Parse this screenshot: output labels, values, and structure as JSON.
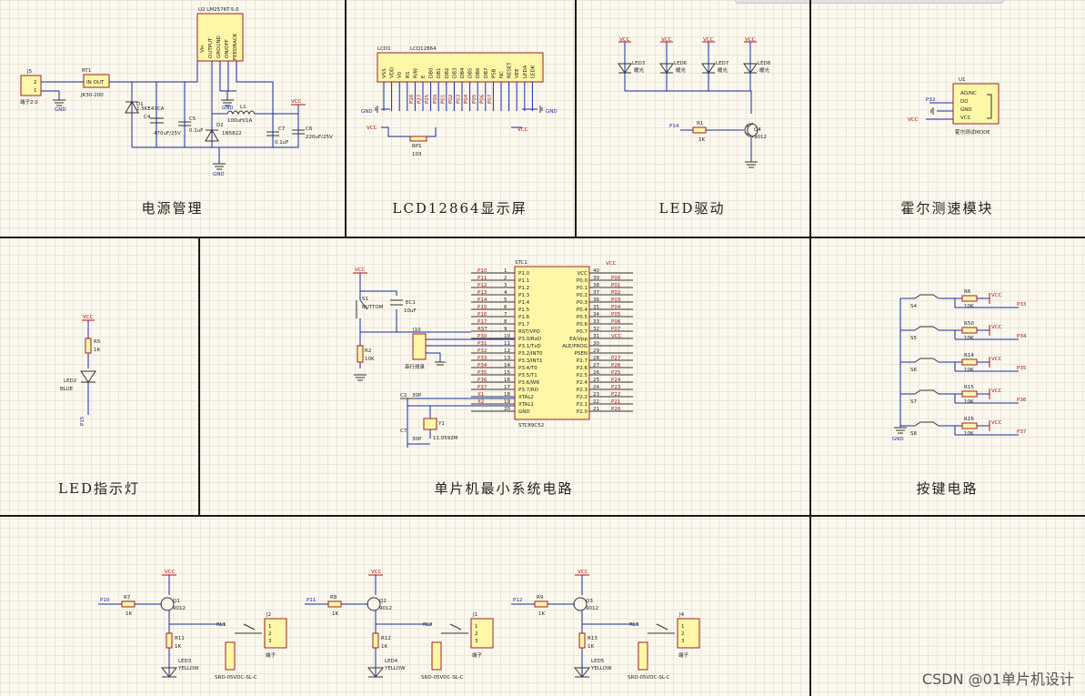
{
  "panels": {
    "power": {
      "title": "电源管理"
    },
    "lcd": {
      "title": "LCD12864显示屏"
    },
    "led_drive": {
      "title": "LED驱动"
    },
    "hall": {
      "title": "霍尔测速模块"
    },
    "led_indicator": {
      "title": "LED指示灯"
    },
    "mcu": {
      "title": "单片机最小系统电路"
    },
    "keys": {
      "title": "按键电路"
    }
  },
  "power_labels": {
    "u2": "U2  LM2576T-5.0",
    "u2_pins": [
      "Vin",
      "OUTPUT",
      "GROUND",
      "ON/OFF",
      "FEEDBACK"
    ],
    "j5": "J5",
    "j5_name": "端子2.0",
    "j5_pins": [
      "2",
      "1"
    ],
    "rt1": "RT1",
    "rt1_name": "IN OUT",
    "rt1_val": "JK30-200",
    "d1": "D1",
    "d1_val": "1.5KE47CA",
    "c4": "C4",
    "c4_val": "470uF/25V",
    "c5": "C5",
    "c5_val": "0.1uF",
    "d2": "D2",
    "d2_val": "1N5822",
    "l1": "L1",
    "l1_val": "100uH/1A",
    "c7": "C7",
    "c7_val": "0.1uF",
    "c6": "C6",
    "c6_val": "220uF/25V",
    "gnd": "GND",
    "vcc": "VCC"
  },
  "lcd_labels": {
    "ref": "LCD1",
    "name": "LCD12864",
    "pins": [
      "VSS",
      "VDD",
      "V0",
      "RS",
      "R/W",
      "E",
      "DB0",
      "DB1",
      "DB2",
      "DB3",
      "DB4",
      "DB5",
      "DB6",
      "DB7",
      "PSB",
      "NC",
      "RESET",
      "VEE",
      "LEDA",
      "LEDK"
    ],
    "nets": [
      "P26",
      "P27",
      "P25",
      "P00",
      "P01",
      "P02",
      "P03",
      "P04",
      "P05",
      "P06",
      "P07"
    ],
    "rp": "RP1",
    "rp_val": "103",
    "gnd": "GND",
    "vcc": "VCC"
  },
  "led_drive_labels": {
    "vcc": "VCC",
    "leds": [
      "LED3",
      "LED6",
      "LED7",
      "LED8"
    ],
    "led_val": "暖光",
    "r": "R1",
    "r_val": "1K",
    "net": "P14",
    "q": "Q4",
    "q_val": "9012"
  },
  "hall_labels": {
    "u": "U1",
    "pins": [
      "AO/NC",
      "DO",
      "GND",
      "VCC"
    ],
    "net": "P32",
    "vcc": "VCC",
    "name": "霍尔测试MODE"
  },
  "indicator_labels": {
    "vcc": "VCC",
    "r": "R5",
    "r_val": "1K",
    "led": "LED2",
    "led_val": "BLUE",
    "net": "P15"
  },
  "mcu_labels": {
    "chip": "STC1",
    "chip_name": "STC89C52",
    "left_pins": [
      "P1.0",
      "P1.1",
      "P1.2",
      "P1.3",
      "P1.4",
      "P1.5",
      "P1.6",
      "P1.7",
      "RST/VPD",
      "P3.0/RxD",
      "P3.1/TxD",
      "P3.2/INT0",
      "P3.3/INT1",
      "P3.4/T0",
      "P3.5/T1",
      "P3.6/WR",
      "P3.7/RD",
      "XTAL2",
      "XTAL1",
      "GND"
    ],
    "left_nums": [
      "1",
      "2",
      "3",
      "4",
      "5",
      "6",
      "7",
      "8",
      "9",
      "10",
      "11",
      "12",
      "13",
      "14",
      "15",
      "16",
      "17",
      "18",
      "19",
      "20"
    ],
    "left_nets": [
      "P10",
      "P11",
      "P12",
      "P13",
      "P14",
      "P15",
      "P16",
      "P17",
      "RST",
      "P30",
      "P31",
      "P32",
      "P33",
      "P34",
      "P35",
      "P36",
      "P37",
      "X1",
      "X2",
      ""
    ],
    "right_pins": [
      "VCC",
      "P0.0",
      "P0.1",
      "P0.2",
      "P0.3",
      "P0.4",
      "P0.5",
      "P0.6",
      "P0.7",
      "EA/Vpp",
      "ALE/PROG",
      "PSEN",
      "P2.7",
      "P2.6",
      "P2.5",
      "P2.4",
      "P2.3",
      "P2.2",
      "P2.1",
      "P2.0"
    ],
    "right_nums": [
      "40",
      "39",
      "38",
      "37",
      "36",
      "35",
      "34",
      "33",
      "32",
      "31",
      "30",
      "29",
      "28",
      "27",
      "26",
      "25",
      "24",
      "23",
      "22",
      "21"
    ],
    "right_nets": [
      "",
      "P00",
      "P01",
      "P02",
      "P03",
      "P04",
      "P05",
      "P06",
      "P07",
      "VCC",
      "",
      "",
      "P27",
      "P26",
      "P25",
      "P24",
      "P23",
      "P22",
      "P21",
      "P20"
    ],
    "vcc": "VCC",
    "s1": "S1",
    "s1_name": "BUTTOM",
    "ec1": "EC1",
    "ec1_val": "10uF",
    "r2": "R2",
    "r2_val": "10K",
    "j10": "J10",
    "j10_name": "串行烧录",
    "c2": "C2",
    "c2_val": "30P",
    "c7": "C7",
    "c7_val": "30P",
    "y1": "Y1",
    "y1_val": "11.0592M"
  },
  "key_labels": {
    "switches": [
      "S4",
      "S5",
      "S6",
      "S7",
      "S8"
    ],
    "resistors": [
      "R6",
      "R50",
      "R14",
      "R15",
      "R16"
    ],
    "r_val": "10K",
    "nets": [
      "P33",
      "P34",
      "P35",
      "P36",
      "P37"
    ],
    "vcc": "VCC",
    "gnd": "GND"
  },
  "relay_labels": [
    {
      "net": "P10",
      "r": "R7",
      "r_val": "1K",
      "q": "Q1",
      "q_val": "9012",
      "r2": "R11",
      "r2_val": "1K",
      "led": "LED3",
      "led_val": "YELLOW",
      "rl": "RL1",
      "rl_val": "SRD-05VDC-SL-C",
      "j": "J2",
      "j_name": "端子",
      "vcc": "VCC"
    },
    {
      "net": "P11",
      "r": "R8",
      "r_val": "1K",
      "q": "Q2",
      "q_val": "9012",
      "r2": "R12",
      "r2_val": "1K",
      "led": "LED4",
      "led_val": "YELLOW",
      "rl": "RL2",
      "rl_val": "SRD-05VDC-SL-C",
      "j": "J1",
      "j_name": "端子",
      "vcc": "VCC"
    },
    {
      "net": "P12",
      "r": "R9",
      "r_val": "1K",
      "q": "Q3",
      "q_val": "9012",
      "r2": "R13",
      "r2_val": "1K",
      "led": "LED5",
      "led_val": "YELLOW",
      "rl": "RL3",
      "rl_val": "SRD-05VDC-SL-C",
      "j": "J4",
      "j_name": "端子",
      "vcc": "VCC"
    }
  ],
  "watermark": "CSDN @01单片机设计"
}
